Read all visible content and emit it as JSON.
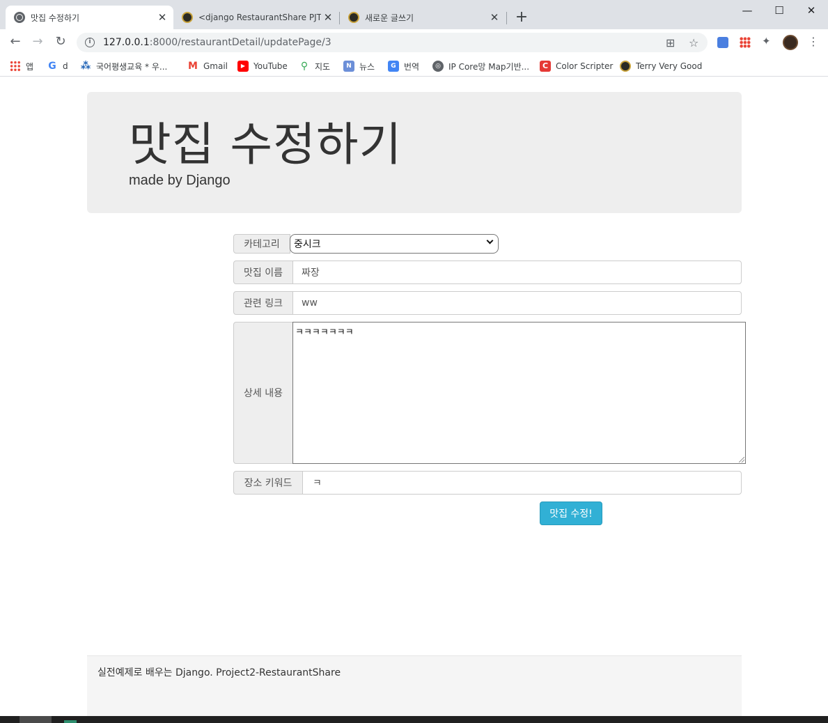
{
  "browser": {
    "tabs": [
      {
        "title": "맛집 수정하기",
        "active": true
      },
      {
        "title": "<django RestaurantShare PJT>",
        "active": false
      },
      {
        "title": "새로운 글쓰기",
        "active": false
      }
    ],
    "url_host": "127.0.0.1",
    "url_path": ":8000/restaurantDetail/updatePage/3",
    "bookmarks": [
      {
        "label": "앱",
        "icon": "apps-grid-icon"
      },
      {
        "label": "d",
        "icon": "google-icon"
      },
      {
        "label": "국어평생교육 * 우...",
        "icon": "edu-icon"
      },
      {
        "label": "Gmail",
        "icon": "gmail-icon"
      },
      {
        "label": "YouTube",
        "icon": "youtube-icon"
      },
      {
        "label": "지도",
        "icon": "maps-icon"
      },
      {
        "label": "뉴스",
        "icon": "news-icon"
      },
      {
        "label": "번역",
        "icon": "translate-icon"
      },
      {
        "label": "IP Core망 Map기반...",
        "icon": "globe-icon"
      },
      {
        "label": "Color Scripter",
        "icon": "color-scripter-icon"
      },
      {
        "label": "Terry Very Good",
        "icon": "terry-icon"
      }
    ]
  },
  "page": {
    "title": "맛집 수정하기",
    "subtitle": "made by Django",
    "form": {
      "category_label": "카테고리",
      "category_value": "중시크",
      "name_label": "맛집 이름",
      "name_value": "짜장",
      "link_label": "관련 링크",
      "link_value": "ww",
      "content_label": "상세 내용",
      "content_value": "ㅋㅋㅋㅋㅋㅋㅋ",
      "keyword_label": "장소 키워드",
      "keyword_value": "ㅋ",
      "submit_label": "맛집 수정!"
    },
    "footer": "실전예제로 배우는 Django. Project2-RestaurantShare"
  },
  "colors": {
    "button": "#31b0d5",
    "jumbotron": "#eeeeee",
    "tabstrip": "#dee1e6"
  }
}
